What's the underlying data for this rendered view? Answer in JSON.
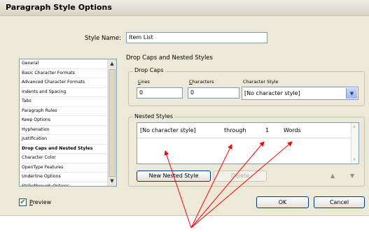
{
  "dialog": {
    "title": "Paragraph Style Options"
  },
  "style_name": {
    "label": "Style Name:",
    "value": "Item List"
  },
  "categories": [
    "General",
    "Basic Character Formats",
    "Advanced Character Formats",
    "Indents and Spacing",
    "Tabs",
    "Paragraph Rules",
    "Keep Options",
    "Hyphenation",
    "Justification",
    "Drop Caps and Nested Styles",
    "Character Color",
    "OpenType Features",
    "Underline Options",
    "Strikethrough Options"
  ],
  "selected_category": "Drop Caps and Nested Styles",
  "panel": {
    "heading": "Drop Caps and Nested Styles",
    "drop_caps": {
      "legend": "Drop Caps",
      "lines_label": "Lines",
      "lines_value": "0",
      "characters_label": "Characters",
      "characters_value": "0",
      "char_style_label": "Character Style",
      "char_style_value": "[No character style]"
    },
    "nested_styles": {
      "legend": "Nested Styles",
      "row": {
        "style": "[No character style]",
        "scope": "through",
        "count": "1",
        "unit": "Words"
      },
      "new_button": "New Nested Style",
      "delete_button": "Delete"
    }
  },
  "footer": {
    "preview_label": "Preview",
    "preview_checked": true,
    "ok_label": "OK",
    "cancel_label": "Cancel"
  },
  "annotation_color": "#ff0000",
  "icons": {
    "scroll_up": "▲",
    "scroll_down": "▼",
    "dropdown": "▼",
    "check": "✔"
  }
}
